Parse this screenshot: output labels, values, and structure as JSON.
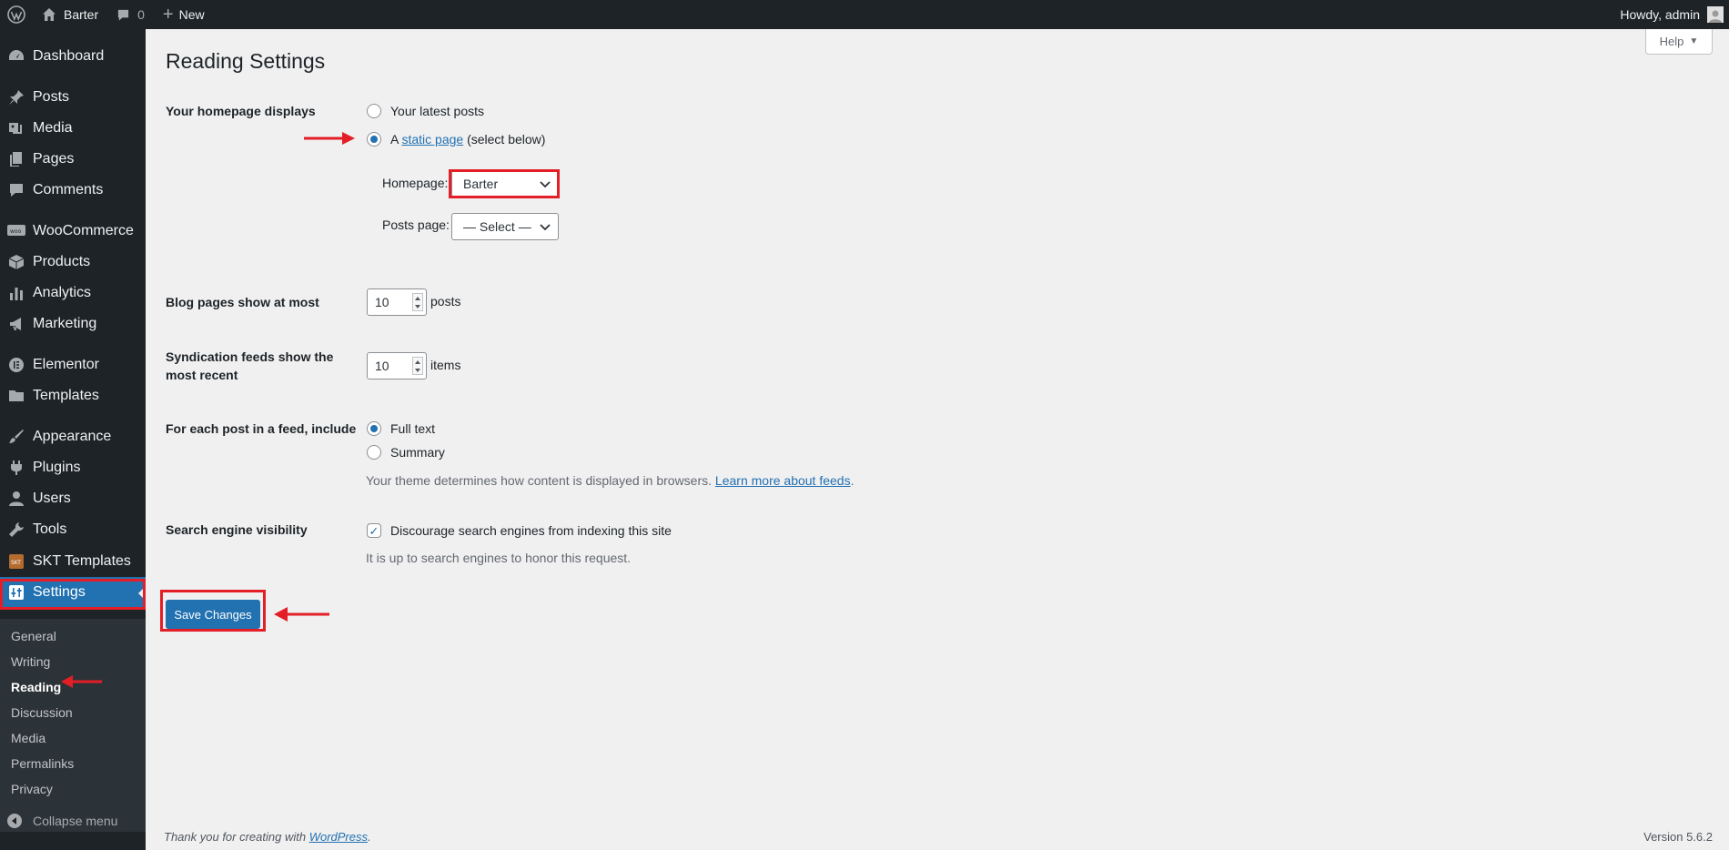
{
  "adminbar": {
    "site_name": "Barter",
    "comments_count": "0",
    "new_label": "New",
    "howdy": "Howdy, admin"
  },
  "sidebar": {
    "items": [
      {
        "label": "Dashboard",
        "icon": "dashboard-icon"
      },
      {
        "label": "Posts",
        "icon": "pin-icon"
      },
      {
        "label": "Media",
        "icon": "media-icon"
      },
      {
        "label": "Pages",
        "icon": "pages-icon"
      },
      {
        "label": "Comments",
        "icon": "comment-icon"
      },
      {
        "label": "WooCommerce",
        "icon": "woocommerce-icon"
      },
      {
        "label": "Products",
        "icon": "box-icon"
      },
      {
        "label": "Analytics",
        "icon": "bar-chart-icon"
      },
      {
        "label": "Marketing",
        "icon": "megaphone-icon"
      },
      {
        "label": "Elementor",
        "icon": "elementor-icon"
      },
      {
        "label": "Templates",
        "icon": "folder-icon"
      },
      {
        "label": "Appearance",
        "icon": "paintbrush-icon"
      },
      {
        "label": "Plugins",
        "icon": "plug-icon"
      },
      {
        "label": "Users",
        "icon": "user-icon"
      },
      {
        "label": "Tools",
        "icon": "wrench-icon"
      },
      {
        "label": "SKT Templates",
        "icon": "skt-icon"
      },
      {
        "label": "Settings",
        "icon": "settings-icon"
      }
    ],
    "submenu": [
      "General",
      "Writing",
      "Reading",
      "Discussion",
      "Media",
      "Permalinks",
      "Privacy"
    ],
    "current_submenu": "Reading",
    "collapse_label": "Collapse menu"
  },
  "header": {
    "help_label": "Help",
    "title": "Reading Settings"
  },
  "form": {
    "homepage_displays": {
      "label": "Your homepage displays",
      "option_latest": "Your latest posts",
      "option_static_prefix": "A",
      "option_static_link": "static page",
      "option_static_suffix": "(select below)",
      "selected": "static page"
    },
    "homepage_select": {
      "label": "Homepage:",
      "value": "Barter"
    },
    "posts_page_select": {
      "label": "Posts page:",
      "value": "— Select —"
    },
    "blog_pages": {
      "label": "Blog pages show at most",
      "value": "10",
      "unit": "posts"
    },
    "syndication": {
      "label_line1": "Syndication feeds show the",
      "label_line2": "most recent",
      "value": "10",
      "unit": "items"
    },
    "feed_include": {
      "label": "For each post in a feed, include",
      "option_full": "Full text",
      "option_summary": "Summary",
      "selected": "Full text",
      "description": "Your theme determines how content is displayed in browsers.",
      "learn_more": "Learn more about feeds",
      "learn_more_suffix": "."
    },
    "search_visibility": {
      "label": "Search engine visibility",
      "checkbox_label": "Discourage search engines from indexing this site",
      "checked": true,
      "description": "It is up to search engines to honor this request."
    },
    "save_label": "Save Changes"
  },
  "footer": {
    "thanks_prefix": "Thank you for creating with",
    "thanks_link": "WordPress",
    "thanks_suffix": ".",
    "version": "Version 5.6.2"
  },
  "colors": {
    "accent": "#2271b1",
    "adminbar_bg": "#1d2327",
    "annotation_red": "#e41e26"
  }
}
